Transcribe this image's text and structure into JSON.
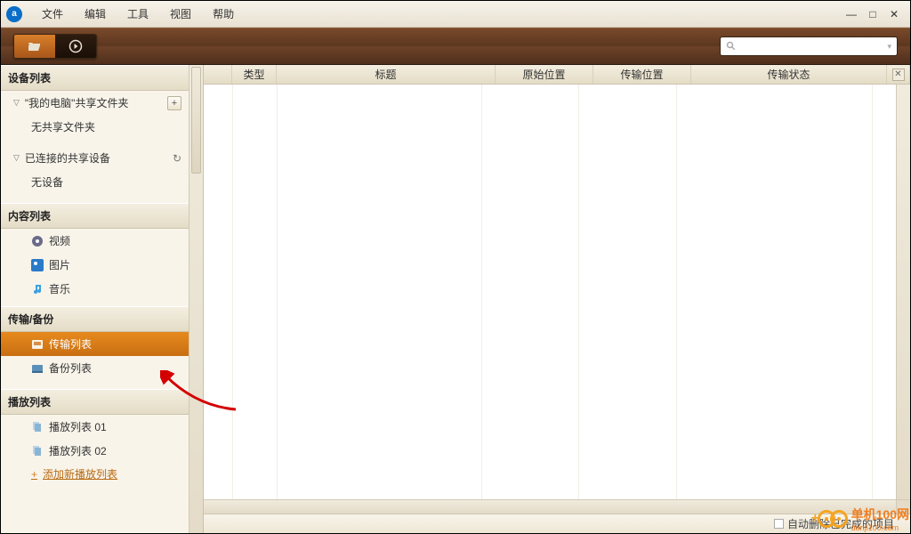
{
  "menubar": {
    "items": [
      "文件",
      "编辑",
      "工具",
      "视图",
      "帮助"
    ]
  },
  "toolbar": {
    "search_placeholder": ""
  },
  "sidebar": {
    "devices_hdr": "设备列表",
    "mypc_label": "\"我的电脑\"共享文件夹",
    "no_shared": "无共享文件夹",
    "connected_label": "已连接的共享设备",
    "no_device": "无设备",
    "content_hdr": "内容列表",
    "video": "视频",
    "photo": "图片",
    "music": "音乐",
    "transfer_hdr": "传输/备份",
    "transfer_list": "传输列表",
    "backup_list": "备份列表",
    "playlist_hdr": "播放列表",
    "pl1": "播放列表 01",
    "pl2": "播放列表 02",
    "add_pl": "添加新播放列表"
  },
  "columns": {
    "c1": "",
    "c2": "类型",
    "c3": "标题",
    "c4": "原始位置",
    "c5": "传输位置",
    "c6": "传输状态"
  },
  "footer": {
    "autodel": "自动删除已完成的项目"
  },
  "watermark": {
    "brand": "单机100网",
    "url": "danji100.com"
  }
}
